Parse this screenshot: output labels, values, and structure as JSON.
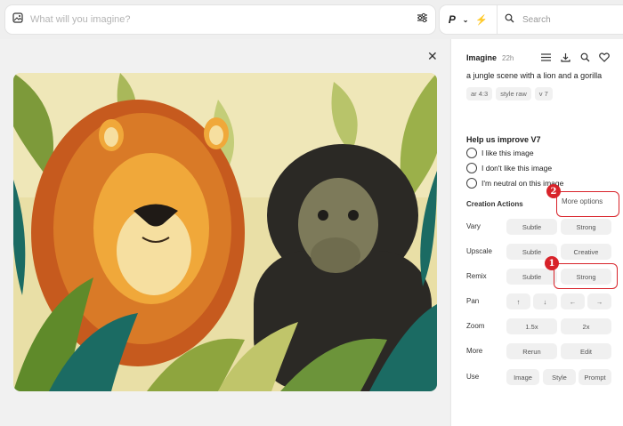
{
  "prompt_bar": {
    "placeholder": "What will you imagine?"
  },
  "mode": {
    "label": "P"
  },
  "search": {
    "label": "Search"
  },
  "panel": {
    "job_type": "Imagine",
    "age": "22h",
    "prompt": "a jungle scene with a lion and a gorilla",
    "params": [
      "ar 4:3",
      "style raw",
      "v 7"
    ],
    "feedback_title": "Help us improve V7",
    "feedback_options": [
      "I like this image",
      "I don't like this image",
      "I'm neutral on this image"
    ],
    "creation_actions": "Creation Actions",
    "more_options": "More options",
    "actions": {
      "vary": {
        "label": "Vary",
        "buttons": [
          "Subtle",
          "Strong"
        ]
      },
      "upscale": {
        "label": "Upscale",
        "buttons": [
          "Subtle",
          "Creative"
        ]
      },
      "remix": {
        "label": "Remix",
        "buttons": [
          "Subtle",
          "Strong"
        ]
      },
      "pan": {
        "label": "Pan",
        "buttons": [
          "↑",
          "↓",
          "←",
          "→"
        ]
      },
      "zoom": {
        "label": "Zoom",
        "buttons": [
          "1.5x",
          "2x"
        ]
      },
      "more": {
        "label": "More",
        "buttons": [
          "Rerun",
          "Edit"
        ]
      },
      "use": {
        "label": "Use",
        "buttons": [
          "Image",
          "Style",
          "Prompt"
        ]
      }
    }
  },
  "annotations": {
    "badge1": "1",
    "badge2": "2",
    "color": "#d8232a"
  }
}
